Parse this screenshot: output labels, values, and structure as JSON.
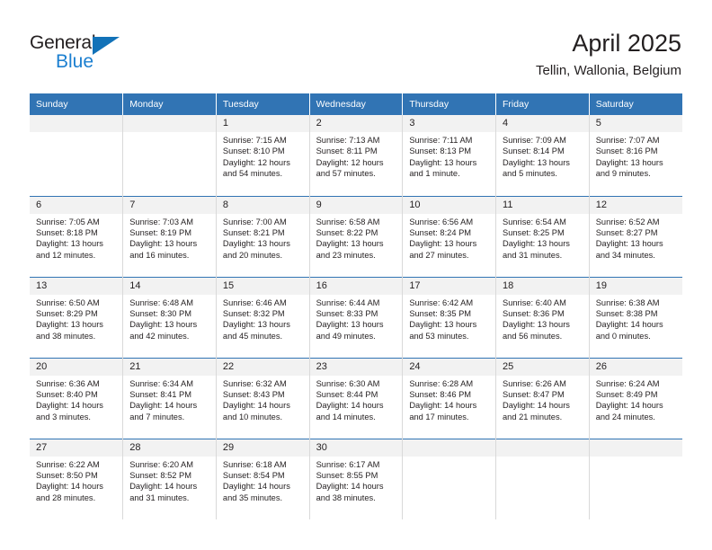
{
  "brand": {
    "name_top": "General",
    "name_bottom": "Blue",
    "triangle_icon": "triangle-icon",
    "accent_color": "#1272b8",
    "blue_text_color": "#1b7fd0"
  },
  "header": {
    "title": "April 2025",
    "location": "Tellin, Wallonia, Belgium"
  },
  "theme": {
    "header_blue": "#3174b4",
    "daynum_gray": "#f2f2f2",
    "cell_border": "#d9d9d9",
    "text": "#231f20"
  },
  "weekdays": [
    "Sunday",
    "Monday",
    "Tuesday",
    "Wednesday",
    "Thursday",
    "Friday",
    "Saturday"
  ],
  "weeks": [
    [
      {
        "empty": true
      },
      {
        "empty": true
      },
      {
        "day": "1",
        "sunrise": "Sunrise: 7:15 AM",
        "sunset": "Sunset: 8:10 PM",
        "daylight1": "Daylight: 12 hours",
        "daylight2": "and 54 minutes."
      },
      {
        "day": "2",
        "sunrise": "Sunrise: 7:13 AM",
        "sunset": "Sunset: 8:11 PM",
        "daylight1": "Daylight: 12 hours",
        "daylight2": "and 57 minutes."
      },
      {
        "day": "3",
        "sunrise": "Sunrise: 7:11 AM",
        "sunset": "Sunset: 8:13 PM",
        "daylight1": "Daylight: 13 hours",
        "daylight2": "and 1 minute."
      },
      {
        "day": "4",
        "sunrise": "Sunrise: 7:09 AM",
        "sunset": "Sunset: 8:14 PM",
        "daylight1": "Daylight: 13 hours",
        "daylight2": "and 5 minutes."
      },
      {
        "day": "5",
        "sunrise": "Sunrise: 7:07 AM",
        "sunset": "Sunset: 8:16 PM",
        "daylight1": "Daylight: 13 hours",
        "daylight2": "and 9 minutes."
      }
    ],
    [
      {
        "day": "6",
        "sunrise": "Sunrise: 7:05 AM",
        "sunset": "Sunset: 8:18 PM",
        "daylight1": "Daylight: 13 hours",
        "daylight2": "and 12 minutes."
      },
      {
        "day": "7",
        "sunrise": "Sunrise: 7:03 AM",
        "sunset": "Sunset: 8:19 PM",
        "daylight1": "Daylight: 13 hours",
        "daylight2": "and 16 minutes."
      },
      {
        "day": "8",
        "sunrise": "Sunrise: 7:00 AM",
        "sunset": "Sunset: 8:21 PM",
        "daylight1": "Daylight: 13 hours",
        "daylight2": "and 20 minutes."
      },
      {
        "day": "9",
        "sunrise": "Sunrise: 6:58 AM",
        "sunset": "Sunset: 8:22 PM",
        "daylight1": "Daylight: 13 hours",
        "daylight2": "and 23 minutes."
      },
      {
        "day": "10",
        "sunrise": "Sunrise: 6:56 AM",
        "sunset": "Sunset: 8:24 PM",
        "daylight1": "Daylight: 13 hours",
        "daylight2": "and 27 minutes."
      },
      {
        "day": "11",
        "sunrise": "Sunrise: 6:54 AM",
        "sunset": "Sunset: 8:25 PM",
        "daylight1": "Daylight: 13 hours",
        "daylight2": "and 31 minutes."
      },
      {
        "day": "12",
        "sunrise": "Sunrise: 6:52 AM",
        "sunset": "Sunset: 8:27 PM",
        "daylight1": "Daylight: 13 hours",
        "daylight2": "and 34 minutes."
      }
    ],
    [
      {
        "day": "13",
        "sunrise": "Sunrise: 6:50 AM",
        "sunset": "Sunset: 8:29 PM",
        "daylight1": "Daylight: 13 hours",
        "daylight2": "and 38 minutes."
      },
      {
        "day": "14",
        "sunrise": "Sunrise: 6:48 AM",
        "sunset": "Sunset: 8:30 PM",
        "daylight1": "Daylight: 13 hours",
        "daylight2": "and 42 minutes."
      },
      {
        "day": "15",
        "sunrise": "Sunrise: 6:46 AM",
        "sunset": "Sunset: 8:32 PM",
        "daylight1": "Daylight: 13 hours",
        "daylight2": "and 45 minutes."
      },
      {
        "day": "16",
        "sunrise": "Sunrise: 6:44 AM",
        "sunset": "Sunset: 8:33 PM",
        "daylight1": "Daylight: 13 hours",
        "daylight2": "and 49 minutes."
      },
      {
        "day": "17",
        "sunrise": "Sunrise: 6:42 AM",
        "sunset": "Sunset: 8:35 PM",
        "daylight1": "Daylight: 13 hours",
        "daylight2": "and 53 minutes."
      },
      {
        "day": "18",
        "sunrise": "Sunrise: 6:40 AM",
        "sunset": "Sunset: 8:36 PM",
        "daylight1": "Daylight: 13 hours",
        "daylight2": "and 56 minutes."
      },
      {
        "day": "19",
        "sunrise": "Sunrise: 6:38 AM",
        "sunset": "Sunset: 8:38 PM",
        "daylight1": "Daylight: 14 hours",
        "daylight2": "and 0 minutes."
      }
    ],
    [
      {
        "day": "20",
        "sunrise": "Sunrise: 6:36 AM",
        "sunset": "Sunset: 8:40 PM",
        "daylight1": "Daylight: 14 hours",
        "daylight2": "and 3 minutes."
      },
      {
        "day": "21",
        "sunrise": "Sunrise: 6:34 AM",
        "sunset": "Sunset: 8:41 PM",
        "daylight1": "Daylight: 14 hours",
        "daylight2": "and 7 minutes."
      },
      {
        "day": "22",
        "sunrise": "Sunrise: 6:32 AM",
        "sunset": "Sunset: 8:43 PM",
        "daylight1": "Daylight: 14 hours",
        "daylight2": "and 10 minutes."
      },
      {
        "day": "23",
        "sunrise": "Sunrise: 6:30 AM",
        "sunset": "Sunset: 8:44 PM",
        "daylight1": "Daylight: 14 hours",
        "daylight2": "and 14 minutes."
      },
      {
        "day": "24",
        "sunrise": "Sunrise: 6:28 AM",
        "sunset": "Sunset: 8:46 PM",
        "daylight1": "Daylight: 14 hours",
        "daylight2": "and 17 minutes."
      },
      {
        "day": "25",
        "sunrise": "Sunrise: 6:26 AM",
        "sunset": "Sunset: 8:47 PM",
        "daylight1": "Daylight: 14 hours",
        "daylight2": "and 21 minutes."
      },
      {
        "day": "26",
        "sunrise": "Sunrise: 6:24 AM",
        "sunset": "Sunset: 8:49 PM",
        "daylight1": "Daylight: 14 hours",
        "daylight2": "and 24 minutes."
      }
    ],
    [
      {
        "day": "27",
        "sunrise": "Sunrise: 6:22 AM",
        "sunset": "Sunset: 8:50 PM",
        "daylight1": "Daylight: 14 hours",
        "daylight2": "and 28 minutes."
      },
      {
        "day": "28",
        "sunrise": "Sunrise: 6:20 AM",
        "sunset": "Sunset: 8:52 PM",
        "daylight1": "Daylight: 14 hours",
        "daylight2": "and 31 minutes."
      },
      {
        "day": "29",
        "sunrise": "Sunrise: 6:18 AM",
        "sunset": "Sunset: 8:54 PM",
        "daylight1": "Daylight: 14 hours",
        "daylight2": "and 35 minutes."
      },
      {
        "day": "30",
        "sunrise": "Sunrise: 6:17 AM",
        "sunset": "Sunset: 8:55 PM",
        "daylight1": "Daylight: 14 hours",
        "daylight2": "and 38 minutes."
      },
      {
        "empty": true
      },
      {
        "empty": true
      },
      {
        "empty": true
      }
    ]
  ]
}
